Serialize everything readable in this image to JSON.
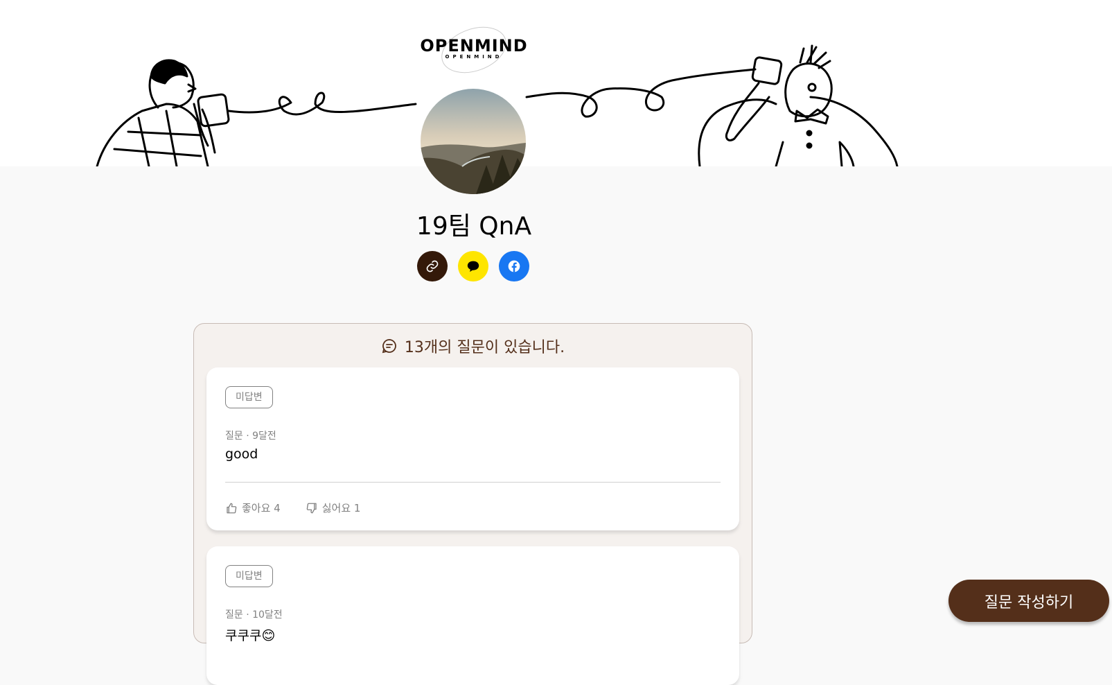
{
  "brand": {
    "logo": "OPENMIND",
    "logo_sub": "OPENMIND"
  },
  "profile": {
    "name": "19팀 QnA",
    "avatar": "landscape-avatar"
  },
  "share": {
    "link_icon": "link-icon",
    "kakao_icon": "kakao-icon",
    "facebook_icon": "facebook-icon",
    "colors": {
      "link": "#341909",
      "kakao": "#fee500",
      "facebook": "#1877f2"
    }
  },
  "feed": {
    "count_text": "13개의 질문이 있습니다.",
    "questions": [
      {
        "status": "미답변",
        "meta": "질문 · 9달전",
        "text": "good",
        "like_label": "좋아요 4",
        "dislike_label": "싫어요 1"
      },
      {
        "status": "미답변",
        "meta": "질문 · 10달전",
        "text": "쿠쿠쿠😊"
      }
    ]
  },
  "fab": {
    "label": "질문 작성하기"
  },
  "colors": {
    "brown": "#542f1a",
    "beige": "#f5f1ee",
    "grey": "#818181"
  }
}
